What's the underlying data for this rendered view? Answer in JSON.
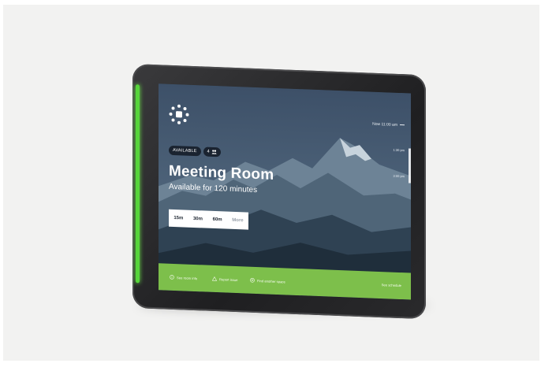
{
  "status_badge": "AVAILABLE",
  "capacity": "4",
  "room_title": "Meeting Room",
  "availability_text": "Available for 120 minutes",
  "time_now": "Now 11:00 am",
  "timeline_times": [
    "1:30 pm",
    "3:00 pm"
  ],
  "book_options": [
    "15m",
    "30m",
    "60m"
  ],
  "book_more": "More",
  "footer": {
    "room_info": "See room info",
    "report_issue": "Report issue",
    "find_space": "Find another space",
    "schedule": "See schedule"
  },
  "colors": {
    "led": "#56d63a",
    "footer": "#7dbf4b",
    "badge": "#1a2330"
  },
  "icons": [
    "logo-icon",
    "people-icon",
    "info-icon",
    "warning-icon",
    "search-icon"
  ]
}
